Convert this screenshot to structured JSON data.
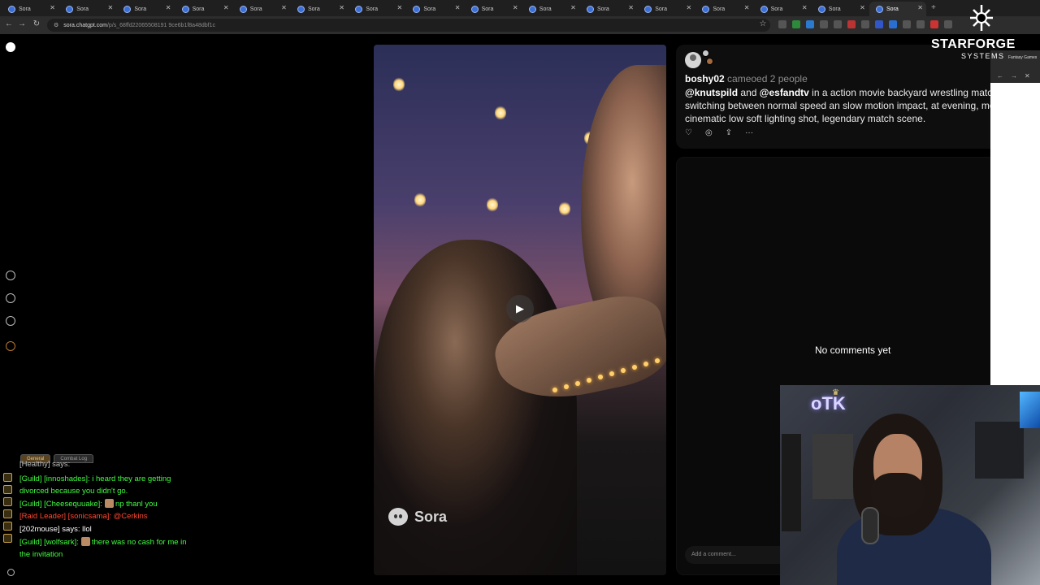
{
  "browser": {
    "tabs": [
      {
        "label": "Sora"
      },
      {
        "label": "Sora"
      },
      {
        "label": "Sora"
      },
      {
        "label": "Sora"
      },
      {
        "label": "Sora"
      },
      {
        "label": "Sora"
      },
      {
        "label": "Sora"
      },
      {
        "label": "Sora"
      },
      {
        "label": "Sora"
      },
      {
        "label": "Sora"
      },
      {
        "label": "Sora"
      },
      {
        "label": "Sora"
      },
      {
        "label": "Sora"
      },
      {
        "label": "Sora"
      },
      {
        "label": "Sora"
      },
      {
        "label": "Sora"
      }
    ],
    "new_tab": "+",
    "url_domain": "sora.chatgpt.com",
    "url_path": "/p/s_68ffd22065508191 9ce6b1f8a48dbf1c",
    "colors": {
      "tab_bg": "#1f1f1f",
      "active_tab": "#2d2d2d",
      "favicon": "#3b6fd8"
    }
  },
  "sora": {
    "post": {
      "username": "boshy02",
      "cameo_text": "cameoed 2 people",
      "mention_1": "@knutspild",
      "and": "and",
      "mention_2": "@esfandtv",
      "caption_line1": "in a action movie backyard wrestling match,",
      "caption_line2": "switching between normal speed an slow motion impact, at evening, mo",
      "caption_line3": "cinematic low soft lighting shot, legendary match scene."
    },
    "watermark": "Sora",
    "comments": {
      "empty_text": "No comments yet",
      "placeholder": "Add a comment..."
    }
  },
  "side_window": {
    "title": "Fantasy Games"
  },
  "overlay": {
    "logo_main": "STARFORGE",
    "logo_sub": "SYSTEMS"
  },
  "chat": {
    "tabs": [
      "General",
      "Combat Log"
    ],
    "lines": [
      {
        "text": "[Healthy] says:",
        "color": "#bfbfbf"
      },
      {
        "text": "[Guild] [innoshades]: i heard they are getting",
        "color": "#40ff40"
      },
      {
        "text": "divorced because you didn't go.",
        "color": "#40ff40"
      },
      {
        "text": "[Guild] [Cheesequuake]:",
        "after": "np thanl you",
        "color": "#40ff40"
      },
      {
        "text": "[Raid Leader] [sonicsama]: @Cerkins",
        "color": "#ff4830"
      },
      {
        "text": "[202mouse] says: llol",
        "color": "#ffffff"
      },
      {
        "text": "[Guild] [wolfsark]:",
        "after": "there was no cash for me in",
        "color": "#40ff40"
      },
      {
        "text": "the invitation",
        "color": "#40ff40"
      }
    ]
  },
  "webcam": {
    "neon_sign": "oTK"
  }
}
